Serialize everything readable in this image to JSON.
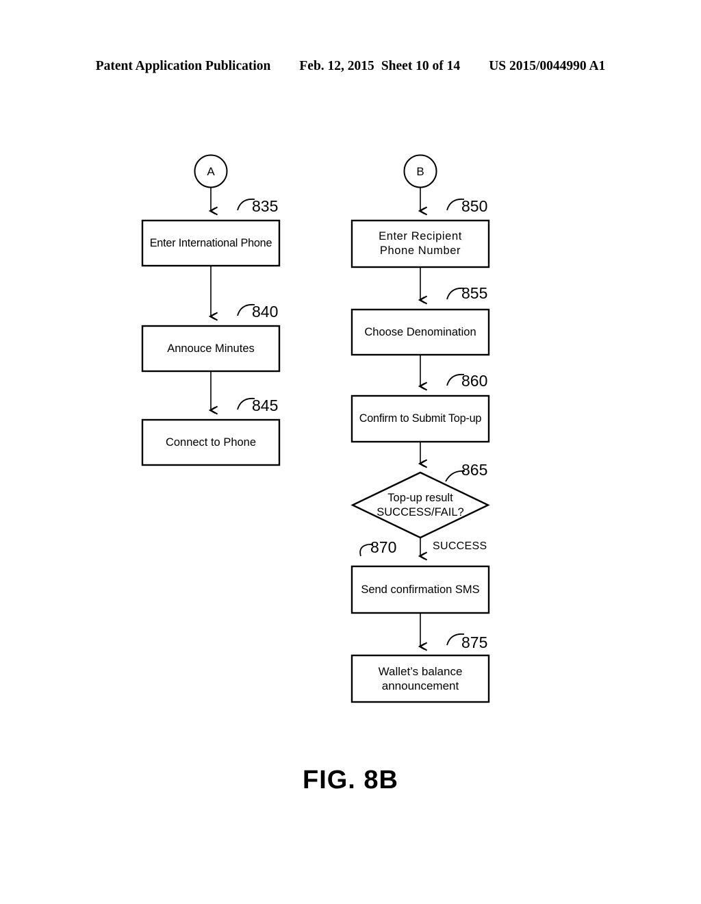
{
  "header": {
    "publication": "Patent Application Publication",
    "date": "Feb. 12, 2015",
    "sheet": "Sheet 10 of 14",
    "patent_number": "US 2015/0044990 A1"
  },
  "figure": {
    "caption": "FIG. 8B"
  },
  "connectors": [
    {
      "id": "A",
      "label": "A"
    },
    {
      "id": "B",
      "label": "B"
    }
  ],
  "left_branch": {
    "nodes": [
      {
        "ref": "835",
        "label": "Enter International Phone",
        "shape": "process"
      },
      {
        "ref": "840",
        "label": "Annouce Minutes",
        "shape": "process"
      },
      {
        "ref": "845",
        "label": "Connect to Phone",
        "shape": "process"
      }
    ]
  },
  "right_branch": {
    "nodes": [
      {
        "ref": "850",
        "label": "Enter  Recipient\nPhone Number",
        "shape": "process"
      },
      {
        "ref": "855",
        "label": "Choose Denomination",
        "shape": "process"
      },
      {
        "ref": "860",
        "label": "Confirm to Submit Top-up",
        "shape": "process"
      },
      {
        "ref": "865",
        "label": "Top-up result\nSUCCESS/FAIL?",
        "shape": "decision"
      },
      {
        "ref": "870",
        "label": "Send confirmation SMS",
        "shape": "process"
      },
      {
        "ref": "875",
        "label": "Wallet’s balance\nannouncement",
        "shape": "process"
      }
    ],
    "edge_labels": [
      {
        "from": "865",
        "to": "870",
        "label": "SUCCESS"
      }
    ]
  },
  "colors": {
    "ink": "#000000",
    "page": "#ffffff"
  }
}
